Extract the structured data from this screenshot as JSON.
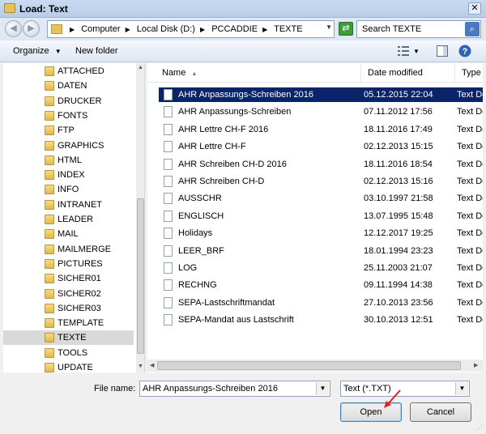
{
  "window": {
    "title": "Load: Text",
    "close_glyph": "✕"
  },
  "address": {
    "crumbs": [
      "Computer",
      "Local Disk (D:)",
      "PCCADDIE",
      "TEXTE"
    ],
    "search_placeholder": "Search TEXTE"
  },
  "toolbar": {
    "organize_label": "Organize",
    "new_folder_label": "New folder"
  },
  "sidebar": {
    "items": [
      {
        "label": "ATTACHED"
      },
      {
        "label": "DATEN"
      },
      {
        "label": "DRUCKER"
      },
      {
        "label": "FONTS"
      },
      {
        "label": "FTP"
      },
      {
        "label": "GRAPHICS"
      },
      {
        "label": "HTML"
      },
      {
        "label": "INDEX"
      },
      {
        "label": "INFO"
      },
      {
        "label": "INTRANET"
      },
      {
        "label": "LEADER"
      },
      {
        "label": "MAIL"
      },
      {
        "label": "MAILMERGE"
      },
      {
        "label": "PICTURES"
      },
      {
        "label": "SICHER01"
      },
      {
        "label": "SICHER02"
      },
      {
        "label": "SICHER03"
      },
      {
        "label": "TEMPLATE"
      },
      {
        "label": "TEXTE"
      },
      {
        "label": "TOOLS"
      },
      {
        "label": "UPDATE"
      }
    ],
    "selected": "TEXTE"
  },
  "columns": {
    "name": "Name",
    "date": "Date modified",
    "type": "Type"
  },
  "files": [
    {
      "name": "AHR Anpassungs-Schreiben 2016",
      "date": "05.12.2015 22:04",
      "type": "Text Do"
    },
    {
      "name": "AHR Anpassungs-Schreiben",
      "date": "07.11.2012 17:56",
      "type": "Text Do"
    },
    {
      "name": "AHR Lettre CH-F 2016",
      "date": "18.11.2016 17:49",
      "type": "Text Do"
    },
    {
      "name": "AHR Lettre CH-F",
      "date": "02.12.2013 15:15",
      "type": "Text Do"
    },
    {
      "name": "AHR Schreiben CH-D 2016",
      "date": "18.11.2016 18:54",
      "type": "Text Do"
    },
    {
      "name": "AHR Schreiben CH-D",
      "date": "02.12.2013 15:16",
      "type": "Text Do"
    },
    {
      "name": "AUSSCHR",
      "date": "03.10.1997 21:58",
      "type": "Text Do"
    },
    {
      "name": "ENGLISCH",
      "date": "13.07.1995 15:48",
      "type": "Text Do"
    },
    {
      "name": "Holidays",
      "date": "12.12.2017 19:25",
      "type": "Text Do"
    },
    {
      "name": "LEER_BRF",
      "date": "18.01.1994 23:23",
      "type": "Text Do"
    },
    {
      "name": "LOG",
      "date": "25.11.2003 21:07",
      "type": "Text Do"
    },
    {
      "name": "RECHNG",
      "date": "09.11.1994 14:38",
      "type": "Text Do"
    },
    {
      "name": "SEPA-Lastschriftmandat",
      "date": "27.10.2013 23:56",
      "type": "Text Do"
    },
    {
      "name": "SEPA-Mandat aus Lastschrift",
      "date": "30.10.2013 12:51",
      "type": "Text Do"
    }
  ],
  "footer": {
    "file_name_label": "File name:",
    "file_name_value": "AHR Anpassungs-Schreiben 2016",
    "file_type_value": "Text (*.TXT)",
    "open_label": "Open",
    "cancel_label": "Cancel"
  },
  "colors": {
    "selection": "#0a246a",
    "titlebar": "#c9dbf1"
  }
}
